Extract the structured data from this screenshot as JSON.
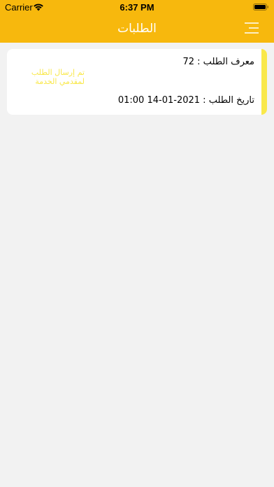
{
  "status_bar": {
    "carrier": "Carrier",
    "time": "6:37 PM"
  },
  "nav": {
    "title": "الطلبات",
    "menu_icon": "menu-icon"
  },
  "orders": [
    {
      "id_line": "معرف الطلب : 72",
      "status_line1": "تم إرسال الطلب",
      "status_line2": "لمقدمي الخدمة",
      "date_line": "تاريخ الطلب : 2021-01-14 01:00"
    }
  ],
  "colors": {
    "header": "#f7b80d",
    "accent": "#f9e84a",
    "background": "#f2f2f2"
  }
}
